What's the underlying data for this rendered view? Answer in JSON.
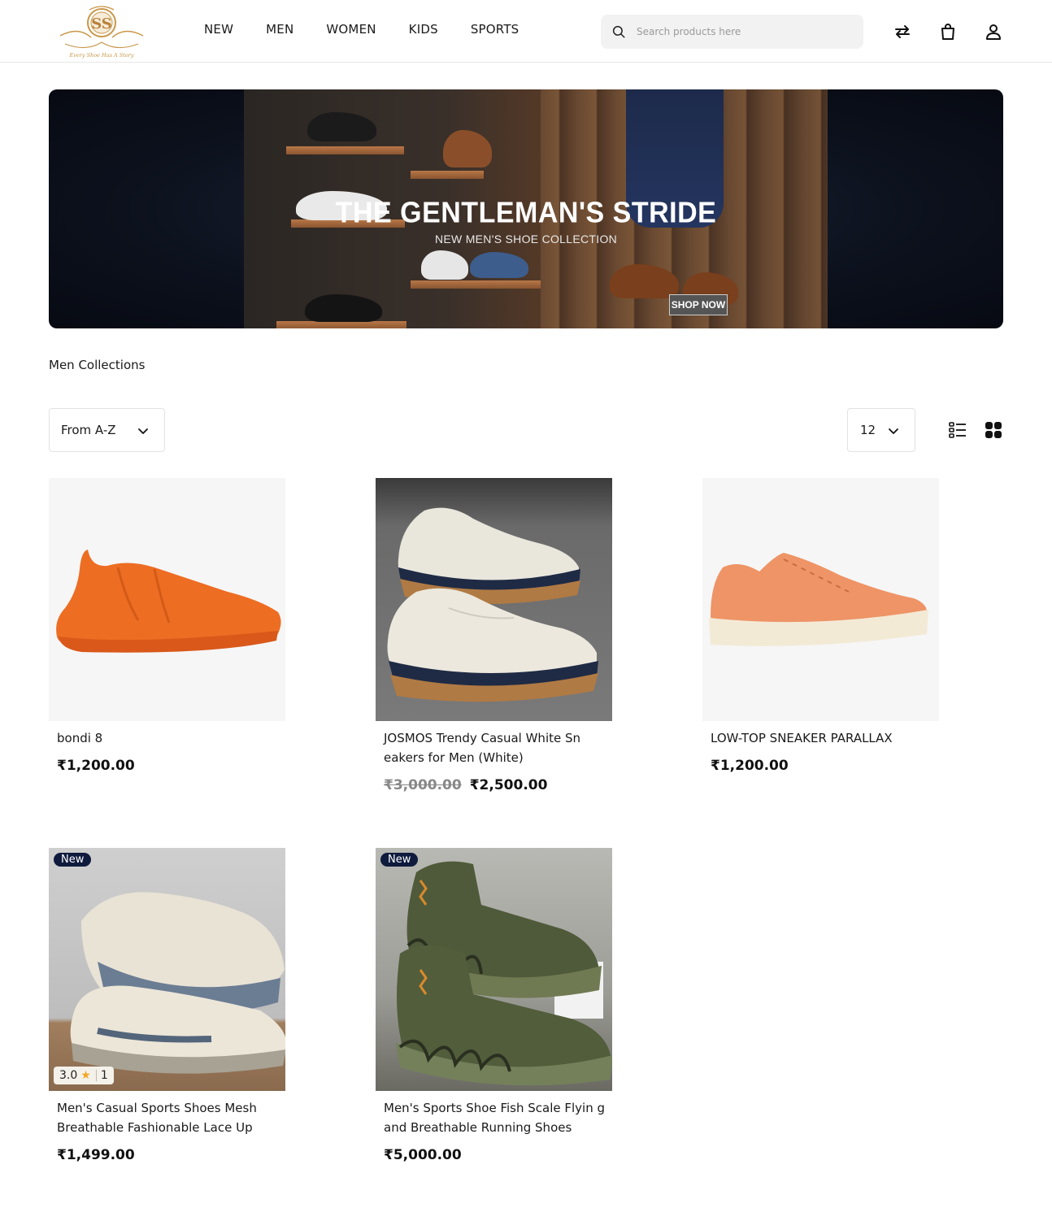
{
  "header": {
    "logo_monogram": "SS",
    "logo_tagline": "Every Shoe Has A Story",
    "nav": [
      "NEW",
      "MEN",
      "WOMEN",
      "KIDS",
      "SPORTS"
    ],
    "search_placeholder": "Search products here"
  },
  "banner": {
    "title": "THE GENTLEMAN'S STRIDE",
    "subtitle": "NEW MEN'S SHOE COLLECTION",
    "cta": "SHOP NOW"
  },
  "section_title": "Men Collections",
  "controls": {
    "sort_value": "From A-Z",
    "per_page_value": "12"
  },
  "products": [
    {
      "name": "bondi 8",
      "price": "₹1,200.00",
      "old_price": "",
      "badge": "",
      "rating": "",
      "rating_count": ""
    },
    {
      "name": "JOSMOS Trendy Casual White Sn eakers for Men (White)",
      "price": "₹2,500.00",
      "old_price": "₹3,000.00",
      "badge": "",
      "rating": "",
      "rating_count": ""
    },
    {
      "name": "LOW-TOP SNEAKER PARALLAX",
      "price": "₹1,200.00",
      "old_price": "",
      "badge": "",
      "rating": "",
      "rating_count": ""
    },
    {
      "name": "Men's Casual Sports Shoes Mesh Breathable Fashionable Lace Up",
      "price": "₹1,499.00",
      "old_price": "",
      "badge": "New",
      "rating": "3.0",
      "rating_count": "1"
    },
    {
      "name": "Men's Sports Shoe Fish Scale Flyin g and Breathable Running Shoes",
      "price": "₹5,000.00",
      "old_price": "",
      "badge": "New",
      "rating": "",
      "rating_count": ""
    }
  ],
  "icons": {
    "search": "search-icon",
    "compare": "compare-arrows-icon",
    "cart": "shopping-bag-icon",
    "account": "user-icon",
    "list_view": "list-view-icon",
    "grid_view": "grid-view-icon"
  },
  "colors": {
    "badge_bg": "#0f1b3d",
    "logo_gold": "#c9974a",
    "star": "#f5a623"
  }
}
